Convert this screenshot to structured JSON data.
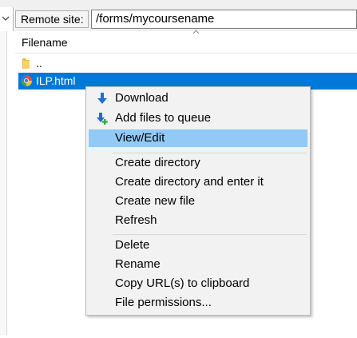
{
  "remote_site": {
    "label": "Remote site:",
    "path": "/forms/mycoursename"
  },
  "file_list": {
    "column_header": "Filename",
    "items": [
      {
        "name": "..",
        "icon": "folder-icon"
      },
      {
        "name": "ILP.html",
        "icon": "html-file-icon",
        "selected": true
      }
    ]
  },
  "context_menu": {
    "items": [
      {
        "label": "Download",
        "icon": "download-arrow-icon"
      },
      {
        "label": "Add files to queue",
        "icon": "add-to-queue-icon"
      },
      {
        "label": "View/Edit",
        "highlighted": true
      },
      {
        "label": "Create directory"
      },
      {
        "label": "Create directory and enter it"
      },
      {
        "label": "Create new file"
      },
      {
        "label": "Refresh"
      },
      {
        "label": "Delete"
      },
      {
        "label": "Rename"
      },
      {
        "label": "Copy URL(s) to clipboard"
      },
      {
        "label": "File permissions..."
      }
    ]
  },
  "colors": {
    "selection": "#0078d7",
    "menu_highlight": "#91c9f7",
    "menu_background": "#f2f2f2",
    "icon_blue": "#1e6fd0",
    "icon_green": "#3aa64a"
  }
}
